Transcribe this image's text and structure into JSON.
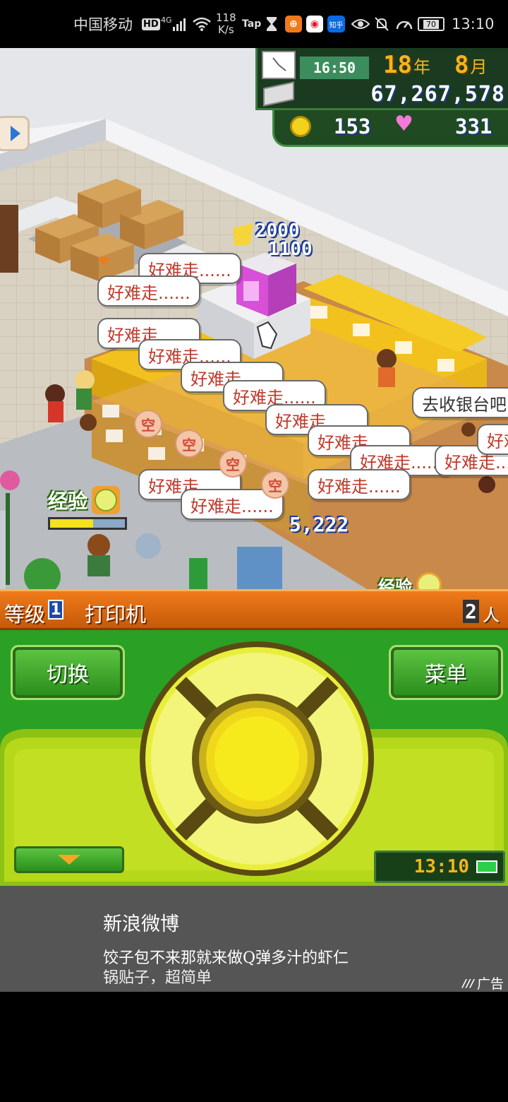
{
  "status_bar": {
    "carrier": "中国移动",
    "hd": "HD",
    "network": "4G",
    "net_speed_value": "118",
    "net_speed_unit": "K/s",
    "tap_label": "Tap",
    "zhihu_label": "知乎",
    "battery_level": "70",
    "time": "13:10"
  },
  "hud": {
    "game_time": "16:50",
    "year": "18",
    "year_unit": "年",
    "month": "8",
    "month_unit": "月",
    "funds": "67,267,578",
    "coins": "153",
    "hearts": "331"
  },
  "scene": {
    "floating_value_top": "2000",
    "floating_value_bottom": "1100",
    "sale_value": "5,222",
    "exp_label": "经验",
    "exp_fill": 0.58,
    "exp_label_2": "经验",
    "cashier_bubble": "去收银台吧",
    "complaint": "好难走......",
    "empty_label": "空",
    "partial_bubble": "好难"
  },
  "info_bar": {
    "level_label": "等级",
    "level": "1",
    "item_name": "打印机",
    "count": "2",
    "count_unit": "人"
  },
  "controller": {
    "switch_label": "切换",
    "menu_label": "菜单",
    "clock": "13:10"
  },
  "ad": {
    "source": "新浪微博",
    "text": "饺子包不来那就来做Q弹多汁的虾仁",
    "text2": "锅贴子，超简单",
    "tag": "广告"
  },
  "colors": {
    "hud_green": "#1b3b21",
    "controller_green": "#2fa52a",
    "info_orange": "#e0700f",
    "ad_gray": "#555555",
    "complaint_red": "#c0392b"
  }
}
